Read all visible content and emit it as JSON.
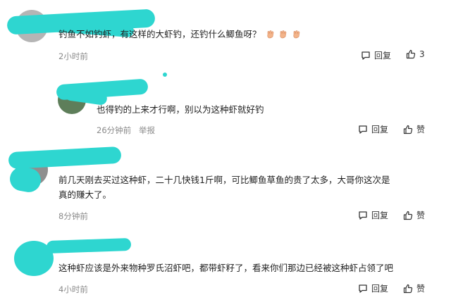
{
  "comments": [
    {
      "text": "钓鱼不如钓虾，有这样的大虾钓，还钓什么鲫鱼呀？",
      "emoji": [
        "clap",
        "clap",
        "clap"
      ],
      "time": "2小时前",
      "reply_label": "回复",
      "like_label": "3"
    },
    {
      "text": "也得钓的上来才行啊，别以为这种虾就好钓",
      "time": "26分钟前",
      "report_label": "举报",
      "reply_label": "回复",
      "like_label": "赞"
    },
    {
      "text_line1": "前几天刚去买过这种虾，二十几快钱1斤啊，可比鲫鱼草鱼的贵了太多，大哥你这次是",
      "text_line2": "真的赚大了。",
      "time": "8分钟前",
      "reply_label": "回复",
      "like_label": "赞"
    },
    {
      "text": "这种虾应该是外来物种罗氏沼虾吧，都带虾籽了，看来你们那边已经被这种虾占领了吧",
      "time": "4小时前",
      "reply_label": "回复",
      "like_label": "赞"
    }
  ],
  "colors": {
    "redaction": "#2ed6d0",
    "meta": "#8a8a8a"
  }
}
